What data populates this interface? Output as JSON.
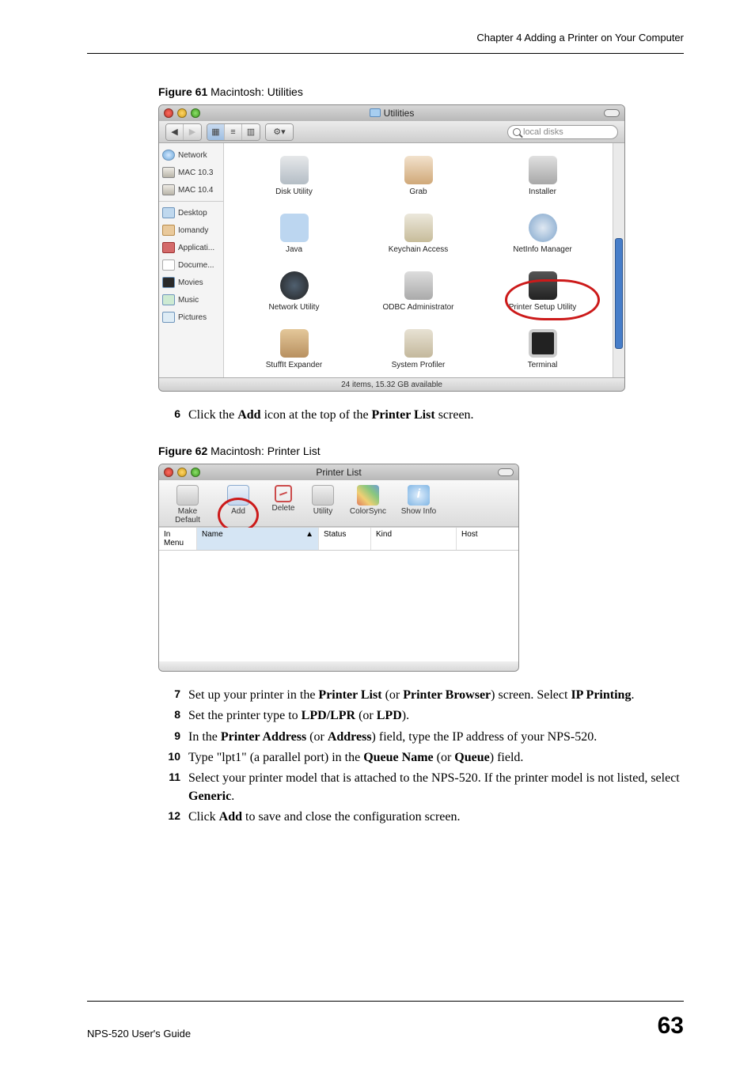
{
  "header": {
    "chapter": "Chapter 4 Adding a Printer on Your Computer"
  },
  "figure61": {
    "label_bold": "Figure 61",
    "label_rest": "   Macintosh: Utilities",
    "title": "Utilities",
    "search_placeholder": "local disks",
    "status": "24 items, 15.32 GB available",
    "sidebar": {
      "vol1": "Network",
      "vol2": "MAC 10.3",
      "vol3": "MAC 10.4",
      "p1": "Desktop",
      "p2": "Iomandy",
      "p3": "Applicati...",
      "p4": "Docume...",
      "p5": "Movies",
      "p6": "Music",
      "p7": "Pictures"
    },
    "apps": {
      "a1": "Disk Utility",
      "a2": "Grab",
      "a3": "Installer",
      "a4": "Java",
      "a5": "Keychain Access",
      "a6": "NetInfo Manager",
      "a7": "Network Utility",
      "a8": "ODBC Administrator",
      "a9": "Printer Setup Utility",
      "a10": "StuffIt Expander",
      "a11": "System Profiler",
      "a12": "Terminal"
    }
  },
  "step6": {
    "num": "6",
    "pre": "Click the ",
    "b1": "Add",
    "mid": " icon at the top of the ",
    "b2": "Printer List",
    "post": " screen."
  },
  "figure62": {
    "label_bold": "Figure 62",
    "label_rest": "   Macintosh: Printer List",
    "title": "Printer List",
    "toolbar": {
      "t1": "Make Default",
      "t2": "Add",
      "t3": "Delete",
      "t4": "Utility",
      "t5": "ColorSync",
      "t6": "Show Info"
    },
    "cols": {
      "c1": "In Menu",
      "c2": "Name",
      "c3": "Status",
      "c4": "Kind",
      "c5": "Host"
    }
  },
  "step7": {
    "num": "7",
    "t1": "Set up your printer in the ",
    "b1": "Printer List",
    "t2": " (or ",
    "b2": "Printer Browser",
    "t3": ") screen. Select ",
    "b3": "IP Printing",
    "t4": "."
  },
  "step8": {
    "num": "8",
    "t1": "Set the printer type to ",
    "b1": "LPD/LPR",
    "t2": " (or ",
    "b2": "LPD",
    "t3": ")."
  },
  "step9": {
    "num": "9",
    "t1": "In the ",
    "b1": "Printer Address",
    "t2": " (or ",
    "b2": "Address",
    "t3": ") field, type the IP address of your NPS-520."
  },
  "step10": {
    "num": "10",
    "t1": "Type \"lpt1\" (a parallel port) in the ",
    "b1": "Queue Name",
    "t2": " (or ",
    "b2": "Queue",
    "t3": ") field."
  },
  "step11": {
    "num": "11",
    "t1": "Select your printer model that is attached to the NPS-520. If the printer model is not listed, select ",
    "b1": "Generic",
    "t2": "."
  },
  "step12": {
    "num": "12",
    "t1": "Click ",
    "b1": "Add",
    "t2": " to save and close the configuration screen."
  },
  "footer": {
    "left": "NPS-520 User's Guide",
    "right": "63"
  }
}
